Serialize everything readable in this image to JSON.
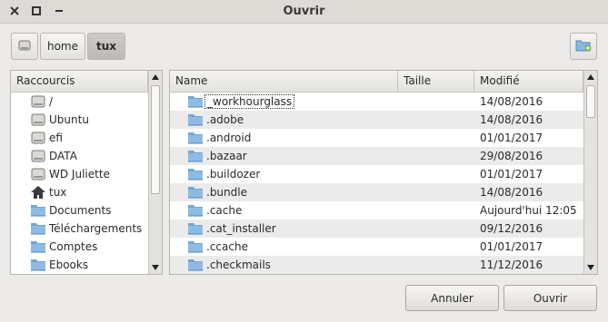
{
  "window": {
    "title": "Ouvrir"
  },
  "titlebar_icons": [
    "close-icon",
    "maximize-icon",
    "minimize-icon"
  ],
  "pathbar": {
    "segments": [
      {
        "label": "home"
      },
      {
        "label": "tux"
      }
    ]
  },
  "sidebar": {
    "header": "Raccourcis",
    "items": [
      {
        "label": "/",
        "icon": "drive-icon"
      },
      {
        "label": "Ubuntu",
        "icon": "drive-icon"
      },
      {
        "label": "efi",
        "icon": "drive-icon"
      },
      {
        "label": "DATA",
        "icon": "drive-icon"
      },
      {
        "label": "WD Juliette",
        "icon": "drive-icon"
      },
      {
        "label": "tux",
        "icon": "home-icon"
      },
      {
        "label": "Documents",
        "icon": "folder-icon"
      },
      {
        "label": "Téléchargements",
        "icon": "folder-icon"
      },
      {
        "label": "Comptes",
        "icon": "folder-icon"
      },
      {
        "label": "Ebooks",
        "icon": "folder-icon"
      }
    ]
  },
  "filelist": {
    "columns": {
      "name": "Name",
      "size": "Taille",
      "modified": "Modifié"
    },
    "rows": [
      {
        "name": "_workhourglass",
        "size": "",
        "modified": "14/08/2016"
      },
      {
        "name": ".adobe",
        "size": "",
        "modified": "14/08/2016"
      },
      {
        "name": ".android",
        "size": "",
        "modified": "01/01/2017"
      },
      {
        "name": ".bazaar",
        "size": "",
        "modified": "29/08/2016"
      },
      {
        "name": ".buildozer",
        "size": "",
        "modified": "01/01/2017"
      },
      {
        "name": ".bundle",
        "size": "",
        "modified": "14/08/2016"
      },
      {
        "name": ".cache",
        "size": "",
        "modified": "Aujourd'hui 12:05"
      },
      {
        "name": ".cat_installer",
        "size": "",
        "modified": "09/12/2016"
      },
      {
        "name": ".ccache",
        "size": "",
        "modified": "01/01/2017"
      },
      {
        "name": ".checkmails",
        "size": "",
        "modified": "11/12/2016"
      }
    ]
  },
  "buttons": {
    "cancel": "Annuler",
    "open": "Ouvrir"
  },
  "colors": {
    "folder": "#6fa7d8",
    "folder_dark": "#4a86c0",
    "row_alt": "#ebebeb"
  }
}
